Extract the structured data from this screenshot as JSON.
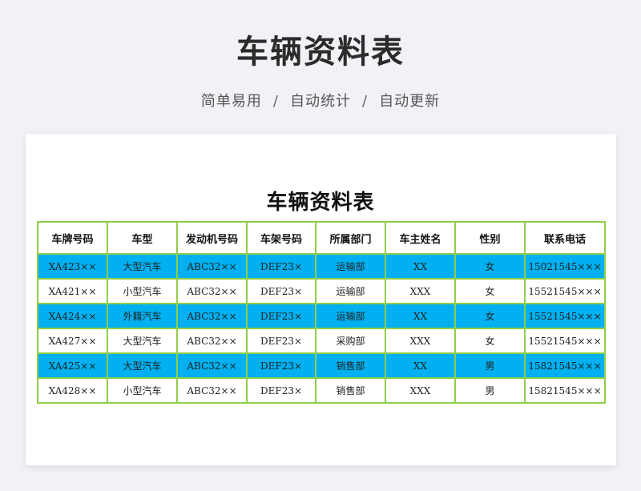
{
  "header": {
    "title": "车辆资料表",
    "subtitle_items": [
      "简单易用",
      "自动统计",
      "自动更新"
    ],
    "subtitle_separator": "/"
  },
  "sheet": {
    "title": "车辆资料表",
    "columns": [
      "车牌号码",
      "车型",
      "发动机号码",
      "车架号码",
      "所属部门",
      "车主姓名",
      "性别",
      "联系电话"
    ],
    "rows": [
      {
        "highlight": true,
        "cells": [
          "XA423××",
          "大型汽车",
          "ABC32××",
          "DEF23×",
          "运输部",
          "XX",
          "女",
          "15021545×××"
        ]
      },
      {
        "highlight": false,
        "cells": [
          "XA421××",
          "小型汽车",
          "ABC32××",
          "DEF23×",
          "运输部",
          "XXX",
          "女",
          "15521545×××"
        ]
      },
      {
        "highlight": true,
        "cells": [
          "XA424××",
          "外籍汽车",
          "ABC32××",
          "DEF23×",
          "运输部",
          "XX",
          "女",
          "15521545×××"
        ]
      },
      {
        "highlight": false,
        "cells": [
          "XA427××",
          "大型汽车",
          "ABC32××",
          "DEF23×",
          "采购部",
          "XXX",
          "女",
          "15521545×××"
        ]
      },
      {
        "highlight": true,
        "cells": [
          "XA425××",
          "大型汽车",
          "ABC32××",
          "DEF23×",
          "销售部",
          "XX",
          "男",
          "15821545×××"
        ]
      },
      {
        "highlight": false,
        "cells": [
          "XA428××",
          "小型汽车",
          "ABC32××",
          "DEF23×",
          "销售部",
          "XXX",
          "男",
          "15821545×××"
        ]
      }
    ]
  },
  "colors": {
    "highlight_row": "#00b0f0",
    "grid_border": "#8fce4a",
    "background": "#f1f2f6"
  }
}
